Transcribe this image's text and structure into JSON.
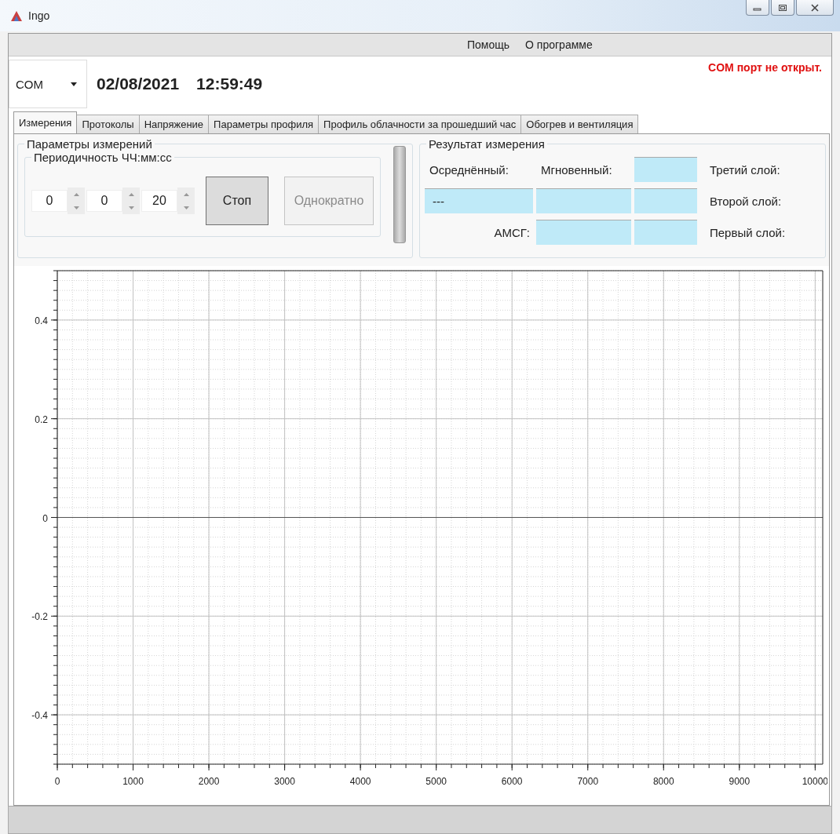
{
  "window": {
    "title": "Ingo"
  },
  "menu": [
    {
      "label": "Помощь"
    },
    {
      "label": "О программе"
    }
  ],
  "header": {
    "port": {
      "value": "COM"
    },
    "date": "02/08/2021",
    "time": "12:59:49",
    "status": "COM порт не открыт."
  },
  "tabs": [
    {
      "label": "Измерения",
      "selected": true
    },
    {
      "label": "Протоколы",
      "selected": false
    },
    {
      "label": "Напряжение",
      "selected": false
    },
    {
      "label": "Параметры профиля",
      "selected": false
    },
    {
      "label": "Профиль облачности за прошедший час",
      "selected": false
    },
    {
      "label": "Обогрев и вентиляция",
      "selected": false
    }
  ],
  "measurement_params": {
    "title": "Параметры измерений",
    "period": {
      "title": "Периодичность ЧЧ:мм:сс",
      "spinners": [
        {
          "value": "0"
        },
        {
          "value": "0"
        },
        {
          "value": "20"
        }
      ]
    },
    "buttons": [
      {
        "label": "Стоп",
        "disabled": false
      },
      {
        "label": "Однократно",
        "disabled": true
      }
    ]
  },
  "result": {
    "title": "Результат измерения",
    "averaged": {
      "label": "Осреднённый:",
      "value": "---"
    },
    "instant": {
      "label": "Мгновенный:"
    },
    "amsg": {
      "label": "АМСГ:"
    },
    "layers": [
      {
        "label": "Третий слой:"
      },
      {
        "label": "Второй слой:"
      },
      {
        "label": "Первый слой:"
      }
    ]
  },
  "chart": {
    "chart_data": {
      "type": "line",
      "grid": true,
      "xlim": [
        0,
        10100
      ],
      "ylim": [
        -0.5,
        0.5
      ],
      "xticks": [
        0,
        1000,
        2000,
        3000,
        4000,
        5000,
        6000,
        7000,
        8000,
        9000,
        10000
      ],
      "yticks": [
        -0.4,
        -0.2,
        0,
        0.2,
        0.4
      ]
    }
  }
}
